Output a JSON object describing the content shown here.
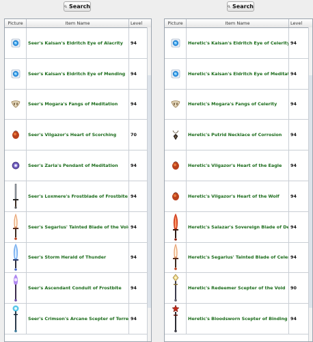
{
  "left_panel": {
    "search_label": "Search",
    "columns": [
      "Picture",
      "Item Name",
      "Level"
    ],
    "rows": [
      {
        "name": "Seer's Kaisan's Eldritch Eye of Alacrity",
        "level": "94",
        "icon": "eye-gem-icon"
      },
      {
        "name": "Seer's Kaisan's Eldritch Eye of Mending",
        "level": "94",
        "icon": "eye-gem-icon"
      },
      {
        "name": "Seer's Mogara's Fangs of Meditation",
        "level": "94",
        "icon": "fangs-icon"
      },
      {
        "name": "Seer's Vilgazor's Heart of Scorching",
        "level": "70",
        "icon": "heart-icon"
      },
      {
        "name": "Seer's Zaria's Pendant of Meditation",
        "level": "94",
        "icon": "pendant-icon"
      },
      {
        "name": "Seer's Loxmere's Frostblade of Frostbite",
        "level": "94",
        "icon": "dagger-icon"
      },
      {
        "name": "Seer's Segarius' Tainted Blade of the Void",
        "level": "94",
        "icon": "flame-blade-icon"
      },
      {
        "name": "Seer's Storm Herald of Thunder",
        "level": "94",
        "icon": "storm-blade-icon"
      },
      {
        "name": "Seer's Ascendant Conduit of Frostbite",
        "level": "94",
        "icon": "violet-staff-icon"
      },
      {
        "name": "Seer's Crimson's Arcane Scepter of Torrents",
        "level": "94",
        "icon": "scepter-icon"
      }
    ]
  },
  "right_panel": {
    "search_label": "Search",
    "columns": [
      "Picture",
      "Item Name",
      "Level"
    ],
    "rows": [
      {
        "name": "Heretic's Kaisan's Eldritch Eye of Celerity",
        "level": "94",
        "icon": "eye-gem-icon"
      },
      {
        "name": "Heretic's Kaisan's Eldritch Eye of Meditation",
        "level": "94",
        "icon": "eye-gem-icon"
      },
      {
        "name": "Heretic's Mogara's Fangs of Celerity",
        "level": "94",
        "icon": "fangs-icon"
      },
      {
        "name": "Heretic's Putrid Necklace of Corrosion",
        "level": "94",
        "icon": "necklace-icon"
      },
      {
        "name": "Heretic's Vilgazor's Heart of the Eagle",
        "level": "94",
        "icon": "heart-icon"
      },
      {
        "name": "Heretic's Vilgazor's Heart of the Wolf",
        "level": "94",
        "icon": "heart-icon"
      },
      {
        "name": "Heretic's Salazar's Sovereign Blade of Decay",
        "level": "94",
        "icon": "red-blade-icon"
      },
      {
        "name": "Heretic's Segarius' Tainted Blade of Celerity",
        "level": "94",
        "icon": "flame-blade-icon"
      },
      {
        "name": "Heretic's Redeemer Scepter of the Void",
        "level": "90",
        "icon": "golden-scepter-icon"
      },
      {
        "name": "Heretic's Bloodsworn Scepter of Binding",
        "level": "94",
        "icon": "star-scepter-icon"
      }
    ]
  }
}
